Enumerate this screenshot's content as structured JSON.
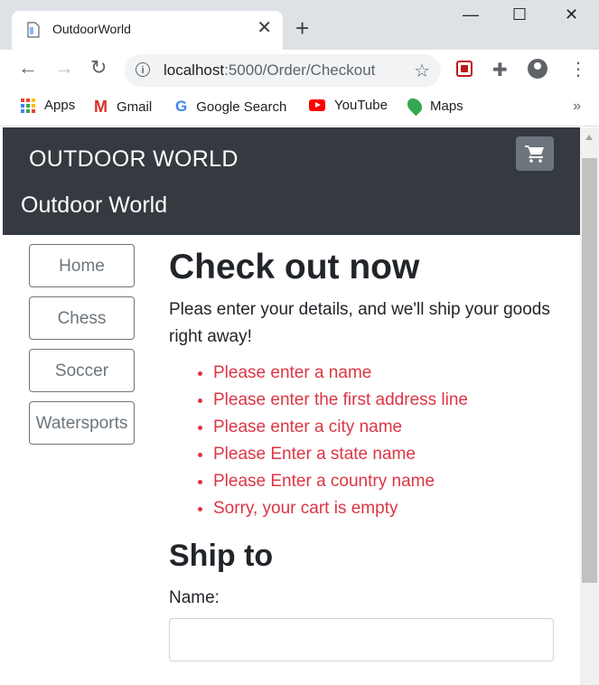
{
  "browser": {
    "tab_title": "OutdoorWorld",
    "tab_close": "✕",
    "new_tab": "+",
    "url_host": "localhost",
    "url_path": ":5000/Order/Checkout",
    "window_minimize": "—",
    "window_maximize": "☐",
    "window_close": "✕",
    "bookmarks": [
      {
        "label": "Apps",
        "icon": "apps-grid-icon"
      },
      {
        "label": "Gmail",
        "icon": "gmail-icon"
      },
      {
        "label": "Google Search",
        "icon": "google-icon"
      },
      {
        "label": "YouTube",
        "icon": "youtube-icon"
      },
      {
        "label": "Maps",
        "icon": "maps-icon"
      }
    ],
    "bookmarks_overflow": "»"
  },
  "site": {
    "brand": "OUTDOOR WORLD",
    "subtitle": "Outdoor World",
    "cart_icon": "cart-icon"
  },
  "categories": [
    "Home",
    "Chess",
    "Soccer",
    "Watersports"
  ],
  "checkout": {
    "title": "Check out now",
    "lead": "Pleas enter your details, and we'll ship your goods right away!",
    "errors": [
      "Please enter a name",
      "Please enter the first address line",
      "Please enter a city name",
      "Please Enter a state name",
      "Please Enter a country name",
      "Sorry, your cart is empty"
    ],
    "ship_to_heading": "Ship to",
    "name_label": "Name:",
    "name_value": ""
  },
  "colors": {
    "navbar_bg": "#343a40",
    "error_text": "#dc3545",
    "secondary": "#6c757d"
  }
}
